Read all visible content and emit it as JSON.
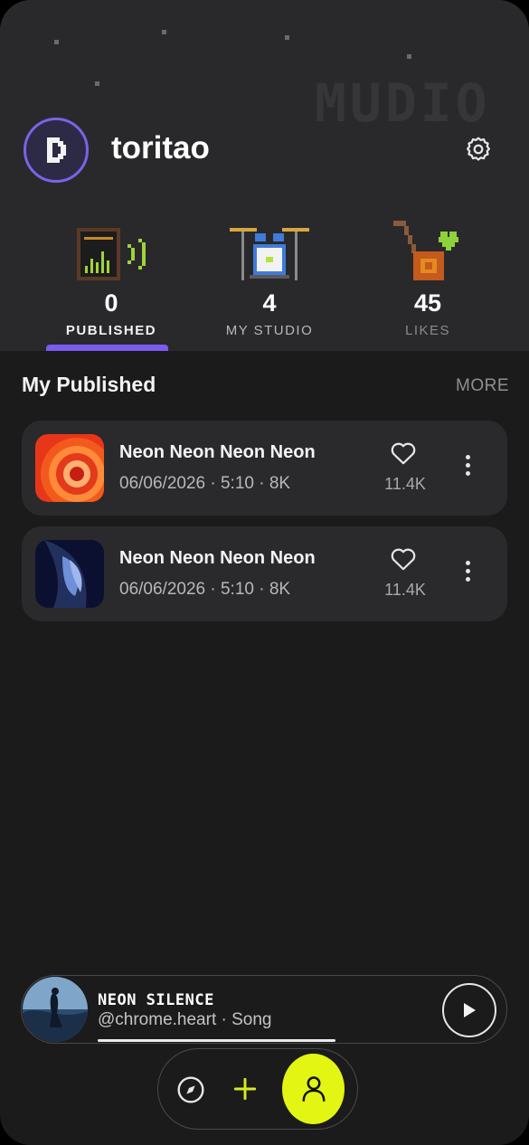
{
  "colors": {
    "background": "#1b1b1c",
    "header": "#29292b",
    "accent_purple": "#7b5cf0",
    "accent_lime": "#e3f512",
    "card": "#2a2a2c"
  },
  "brand": "MUDIO",
  "profile": {
    "avatar_letter": "D",
    "username": "toritao",
    "settings_icon": "gear-icon"
  },
  "stats": [
    {
      "value": "0",
      "label": "PUBLISHED",
      "icon": "amplifier-icon",
      "active": true
    },
    {
      "value": "4",
      "label": "MY STUDIO",
      "icon": "drum-kit-icon"
    },
    {
      "value": "45",
      "label": "LIKES",
      "icon": "guitar-heart-icon"
    }
  ],
  "section": {
    "title": "My Published",
    "more": "MORE"
  },
  "tracks": [
    {
      "title": "Neon Neon Neon Neon",
      "meta": "06/06/2026 · 5:10 · 8K",
      "likes": "11.4K"
    },
    {
      "title": "Neon Neon Neon Neon",
      "meta": "06/06/2026  · 5:10 · 8K",
      "likes": "11.4K"
    }
  ],
  "player": {
    "track": "NEON SILENCE",
    "artist": "@chrome.heart · Song",
    "progress": 0.52
  },
  "nav": {
    "explore_icon": "compass-icon",
    "add_icon": "plus-icon",
    "profile_icon": "user-icon"
  }
}
